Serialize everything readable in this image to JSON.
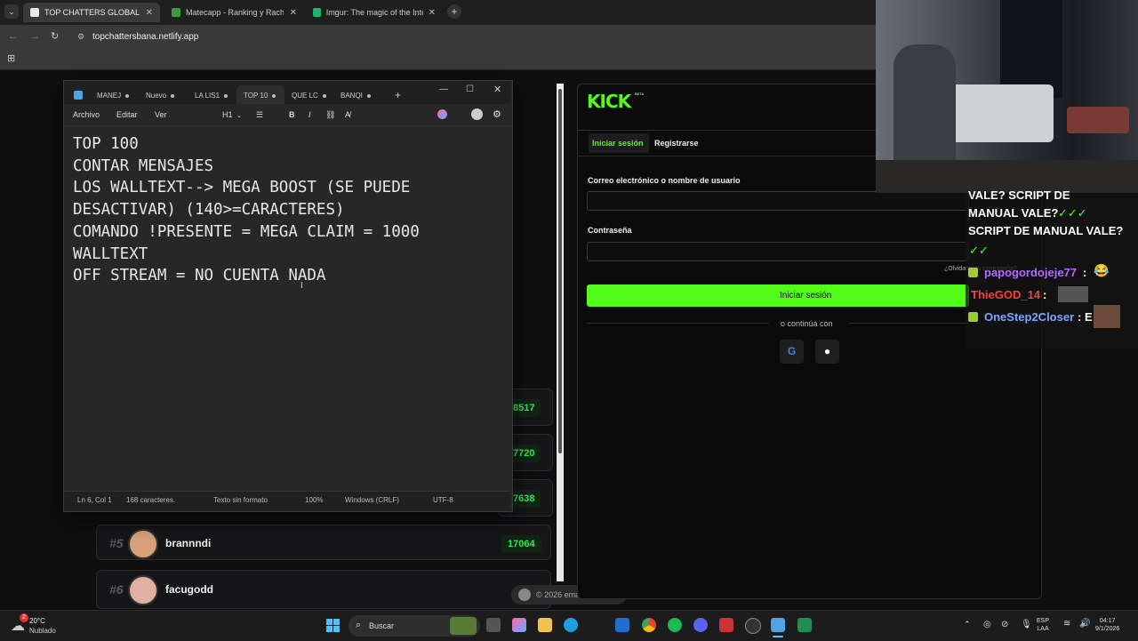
{
  "browser": {
    "tabs": [
      {
        "title": "TOP CHATTERS GLOBAL",
        "active": true
      },
      {
        "title": "Matecapp - Ranking y Racha de"
      },
      {
        "title": "Imgur: The magic of the Interne"
      }
    ],
    "url": "topchattersbana.netlify.app"
  },
  "leaderboard": {
    "hidden_scores": [
      "8517",
      "7720",
      "7638"
    ],
    "rows": [
      {
        "rank": "#5",
        "name": "brannndi",
        "score": "17064"
      },
      {
        "rank": "#6",
        "name": "facugodd",
        "score": ""
      }
    ],
    "footer": "© 2026 emaidana09"
  },
  "notepad": {
    "tabs": [
      "MANEJ",
      "Nuevo",
      "LA LIS1",
      "TOP 10",
      "QUE LC",
      "BANQI"
    ],
    "menu": [
      "Archivo",
      "Editar",
      "Ver"
    ],
    "toolbar": {
      "heading": "H1"
    },
    "content": "TOP 100\nCONTAR MENSAJES\nLOS WALLTEXT--> MEGA BOOST (SE PUEDE\nDESACTIVAR) (140>=CARACTERES)\nCOMANDO !PRESENTE = MEGA CLAIM = 1000\nWALLTEXT\nOFF STREAM = NO CUENTA NADA",
    "status": {
      "position": "Ln 6, Col 1",
      "chars": "168 caracteres.",
      "format": "Texto sin formato",
      "zoom": "100%",
      "line_ending": "Windows (CRLF)",
      "encoding": "UTF-8"
    }
  },
  "kick": {
    "logo": "KICK",
    "beta": "BETA",
    "tabs": {
      "login": "Iniciar sesión",
      "register": "Registrarse"
    },
    "email_label": "Correo electrónico o nombre de usuario",
    "password_label": "Contraseña",
    "forgot": "¿Olvidaste tu contraseña?",
    "submit": "Iniciar sesión",
    "divider": "o continúa con",
    "accent": "#53fc18"
  },
  "chat_overlay": {
    "lines": [
      "VALE? SCRIPT DE",
      "MANUAL VALE?",
      "SCRIPT DE MANUAL VALE?"
    ],
    "messages": [
      {
        "user": "papogordojeje77",
        "color": "#b36cff",
        "text": ":"
      },
      {
        "user": "ThieGOD_14",
        "color": "#ff3b3b",
        "text": ":"
      },
      {
        "user": "OneStep2Closer",
        "color": "#7aa7ff",
        "text": ": E"
      }
    ]
  },
  "taskbar": {
    "weather": {
      "temp": "20°C",
      "desc": "Nublado"
    },
    "search_placeholder": "Buscar",
    "lang": "ESP",
    "lang2": "LAA",
    "time": "04:17",
    "date": "9/1/2026",
    "notification_badge": "2"
  }
}
